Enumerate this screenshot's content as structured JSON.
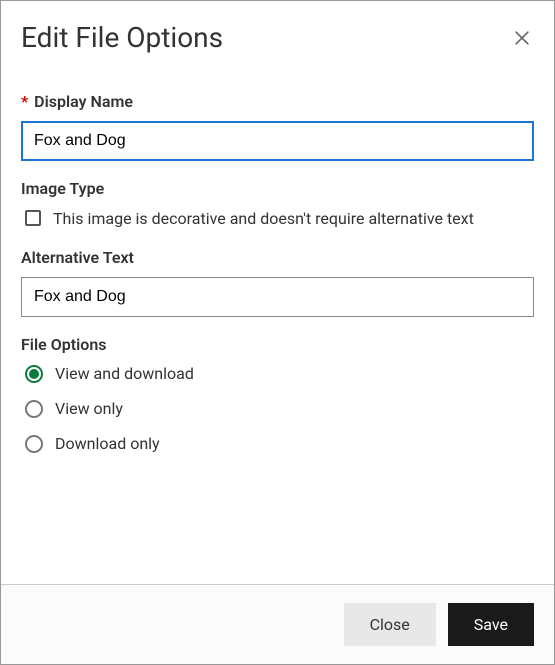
{
  "dialog": {
    "title": "Edit File Options",
    "displayName": {
      "label": "Display Name",
      "required": "*",
      "value": "Fox and Dog"
    },
    "imageType": {
      "label": "Image Type",
      "decorativeCheckbox": "This image is decorative and doesn't require alternative text"
    },
    "altText": {
      "label": "Alternative Text",
      "value": "Fox and Dog"
    },
    "fileOptions": {
      "label": "File Options",
      "options": [
        {
          "label": "View and download",
          "selected": true
        },
        {
          "label": "View only",
          "selected": false
        },
        {
          "label": "Download only",
          "selected": false
        }
      ]
    },
    "footer": {
      "close": "Close",
      "save": "Save"
    }
  }
}
